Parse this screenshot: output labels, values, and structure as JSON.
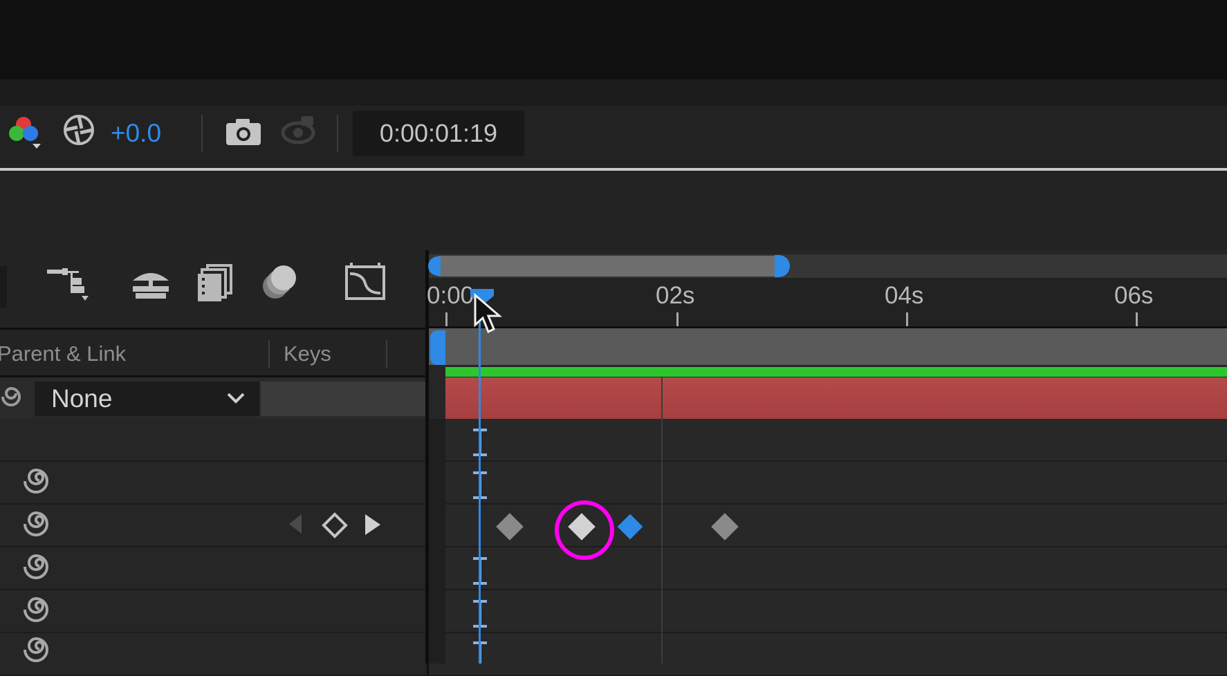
{
  "viewer_toolbar": {
    "exposure_value": "+0.0",
    "timecode": "0:00:01:19",
    "icons": [
      "color-channels-icon",
      "exposure-reset-icon",
      "snapshot-camera-icon",
      "show-snapshot-icon"
    ]
  },
  "timeline_toolbar": {
    "icons": [
      "parent-link-tree-icon",
      "hide-shy-layers-icon",
      "frame-blending-icon",
      "motion-blur-icon",
      "graph-editor-icon"
    ]
  },
  "columns": {
    "parent_link": "Parent & Link",
    "keys": "Keys"
  },
  "layer": {
    "parent_value": "None"
  },
  "ruler": {
    "labels": [
      "0:00",
      "02s",
      "04s",
      "06s"
    ]
  },
  "colors": {
    "accent_blue": "#2e8ae6",
    "layer_bar_red": "#a63f40",
    "green_line": "#2ec52e",
    "highlight_magenta": "#ff00f0"
  }
}
